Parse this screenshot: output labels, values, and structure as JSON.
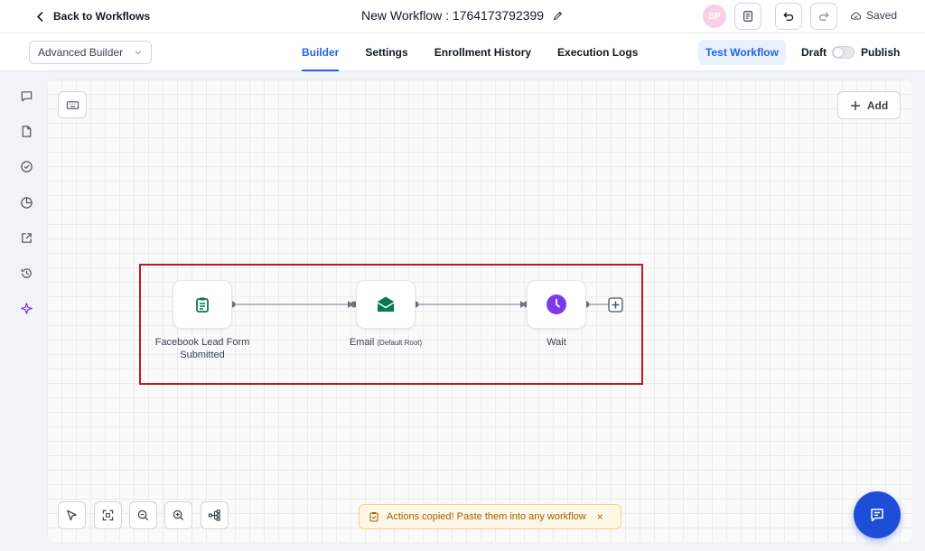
{
  "header": {
    "back_label": "Back to Workflows",
    "workflow_title": "New Workflow : 1764173792399",
    "avatar_initials": "SP",
    "saved_label": "Saved"
  },
  "nav": {
    "builder_mode": "Advanced Builder",
    "tabs": [
      {
        "label": "Builder",
        "active": true
      },
      {
        "label": "Settings",
        "active": false
      },
      {
        "label": "Enrollment History",
        "active": false
      },
      {
        "label": "Execution Logs",
        "active": false
      }
    ],
    "test_label": "Test Workflow",
    "draft_label": "Draft",
    "publish_label": "Publish",
    "publish_enabled": false
  },
  "sidebar": {
    "icons": [
      "message-icon",
      "document-icon",
      "check-circle-icon",
      "pie-chart-icon",
      "external-link-icon",
      "history-icon",
      "sparkle-icon"
    ]
  },
  "canvas": {
    "add_label": "Add",
    "nodes": [
      {
        "label": "Facebook Lead Form Submitted",
        "icon": "clipboard-icon",
        "color": "#047857"
      },
      {
        "label": "Email",
        "label_suffix": "(Default Root)",
        "icon": "envelope-icon",
        "color": "#047857"
      },
      {
        "label": "Wait",
        "icon": "clock-icon",
        "color": "#7c3aed"
      }
    ],
    "toast": "Actions copied! Paste them into any workflow",
    "toast_close": "×"
  },
  "colors": {
    "accent": "#2563eb",
    "highlight": "#b91c1c",
    "fab": "#1d4ed8"
  }
}
